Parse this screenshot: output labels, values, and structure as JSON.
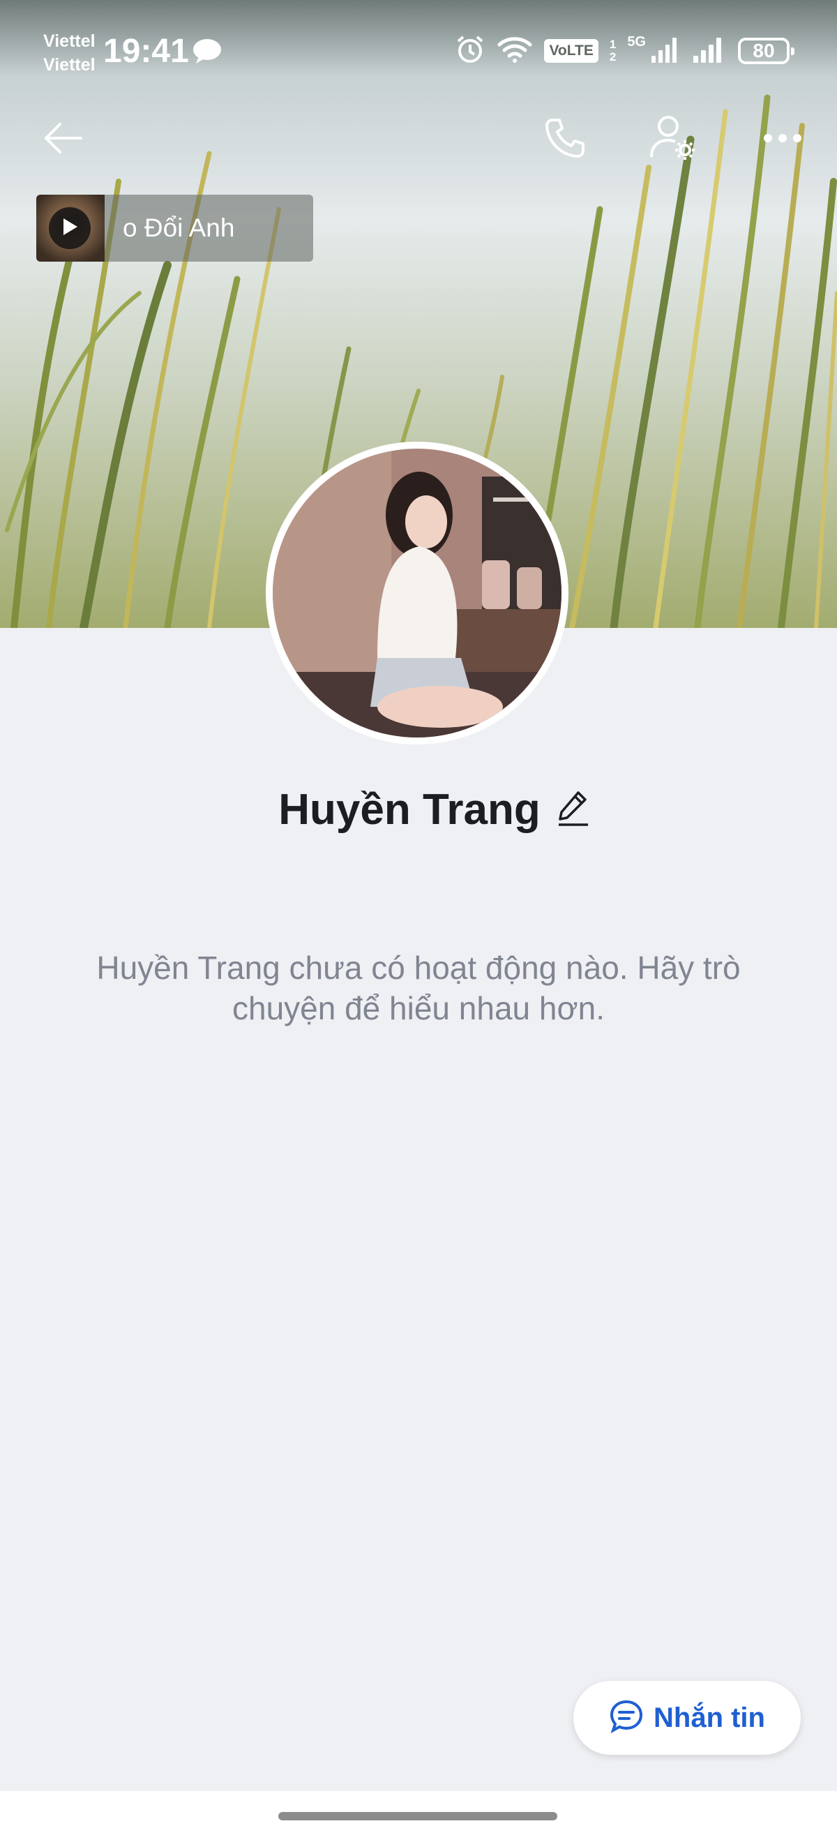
{
  "status_bar": {
    "carrier_line1": "Viettel",
    "carrier_line2": "Viettel",
    "time": "19:41",
    "volte": "VoLTE",
    "sim_slot_1": "1",
    "sim_slot_2": "2",
    "network": "5G",
    "battery": "80",
    "icons": [
      "chat-bubble-icon",
      "alarm-icon",
      "wifi-icon",
      "signal-icon",
      "battery-icon"
    ]
  },
  "header": {
    "icons": [
      "back-arrow-icon",
      "phone-icon",
      "user-settings-icon",
      "more-icon"
    ]
  },
  "music": {
    "title": "o Đổi Anh",
    "icon": "play-icon"
  },
  "profile": {
    "name": "Huyền Trang",
    "edit_icon": "pencil-icon"
  },
  "empty_state": {
    "message": "Huyền Trang chưa có hoạt động nào. Hãy trò chuyện để hiểu nhau hơn."
  },
  "message_button": {
    "label": "Nhắn tin",
    "icon": "chat-icon"
  },
  "colors": {
    "accent": "#1f5fd1",
    "background": "#eff0f4",
    "muted_text": "#7f8591"
  }
}
